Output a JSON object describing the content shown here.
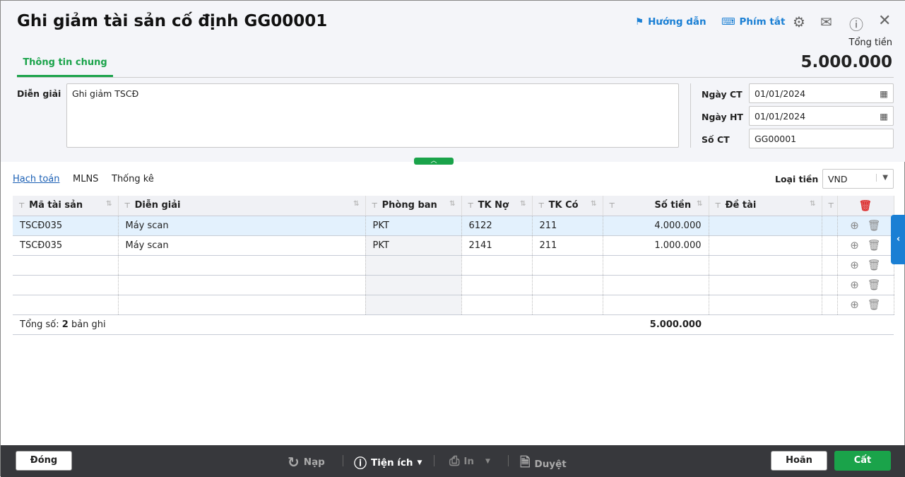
{
  "title": "Ghi giảm tài sản cố định GG00001",
  "toolbar": {
    "guide": "Hướng dẫn",
    "shortcuts": "Phím tắt"
  },
  "total": {
    "label": "Tổng tiền",
    "value": "5.000.000"
  },
  "tabs": [
    "Thông tin chung"
  ],
  "form": {
    "desc_label": "Diễn giải",
    "desc_value": "Ghi giảm TSCĐ",
    "ngay_ct_label": "Ngày CT",
    "ngay_ct": "01/01/2024",
    "ngay_ht_label": "Ngày HT",
    "ngay_ht": "01/01/2024",
    "so_ct_label": "Số CT",
    "so_ct": "GG00001"
  },
  "subtabs": [
    "Hạch toán",
    "MLNS",
    "Thống kê"
  ],
  "currency": {
    "label": "Loại tiền",
    "value": "VND"
  },
  "columns": [
    "Mã tài sản",
    "Diễn giải",
    "Phòng ban",
    "TK Nợ",
    "TK Có",
    "Số tiền",
    "Đề tài"
  ],
  "rows": [
    [
      "TSCĐ035",
      "Máy scan",
      "PKT",
      "6122",
      "211",
      "4.000.000",
      ""
    ],
    [
      "TSCĐ035",
      "Máy scan",
      "PKT",
      "2141",
      "211",
      "1.000.000",
      ""
    ]
  ],
  "summary": {
    "prefix": "Tổng số: ",
    "count": "2",
    "suffix": " bản ghi",
    "total": "5.000.000"
  },
  "footer": {
    "close": "Đóng",
    "reload": "Nạp",
    "utilities": "Tiện ích",
    "print": "In",
    "approve": "Duyệt",
    "cancel": "Hoãn",
    "save": "Cất"
  },
  "colors": {
    "accent_green": "#1aa34a",
    "link_blue": "#1a7fd4",
    "footer_bg": "#37383c"
  }
}
